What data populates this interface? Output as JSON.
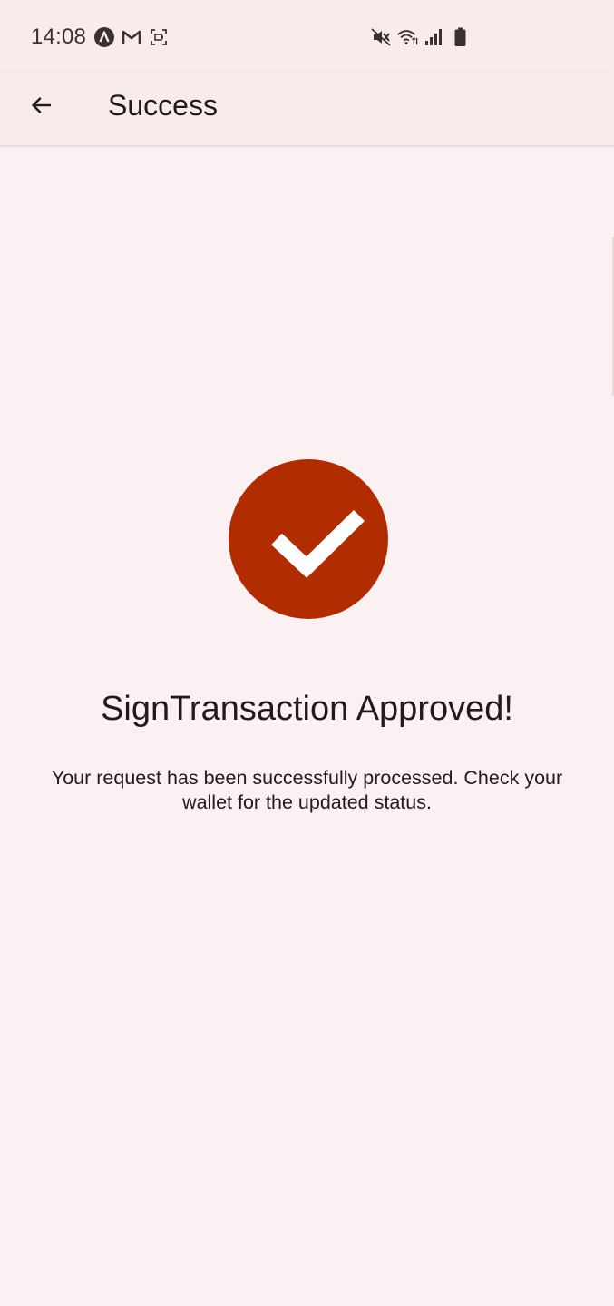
{
  "status_bar": {
    "time": "14:08",
    "left_icons": [
      "notification-app-icon",
      "gmail-icon",
      "screenshot-icon"
    ],
    "right_icons": [
      "mute-vibrate-icon",
      "wifi-icon",
      "signal-icon",
      "battery-icon"
    ]
  },
  "app_bar": {
    "title": "Success",
    "back_icon": "arrow-back-icon"
  },
  "main": {
    "status_icon": "check-icon",
    "headline": "SignTransaction Approved!",
    "message": "Your request has been successfully processed. Check your wallet for the updated status."
  },
  "colors": {
    "accent": "#b12c00",
    "background": "#fcf1f2",
    "app_bar_background": "#f8eceb",
    "text": "#221a1b"
  }
}
